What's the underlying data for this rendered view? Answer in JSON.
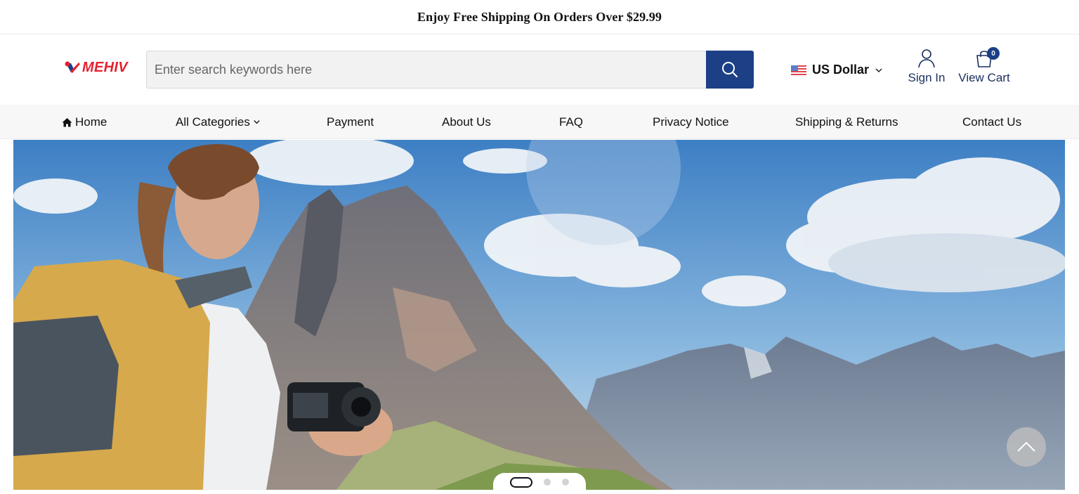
{
  "announcement": {
    "text": "Enjoy Free Shipping On Orders Over $29.99"
  },
  "header": {
    "logo_text": "MEHIV",
    "search": {
      "placeholder": "Enter search keywords here",
      "value": ""
    },
    "currency": {
      "label": "US Dollar",
      "flag_icon": "us-flag-icon"
    },
    "sign_in_label": "Sign In",
    "view_cart_label": "View Cart",
    "cart_count": "0",
    "brand_colors": {
      "accent": "#1c3f86",
      "logo": "#e52130"
    }
  },
  "nav": {
    "home": "Home",
    "all_categories": "All Categories",
    "payment": "Payment",
    "about": "About Us",
    "faq": "FAQ",
    "privacy": "Privacy Notice",
    "shipping": "Shipping & Returns",
    "contact": "Contact Us"
  },
  "hero": {
    "image_description_icon": "hero-banner-image",
    "slides_count": 3,
    "active_slide": 1
  }
}
